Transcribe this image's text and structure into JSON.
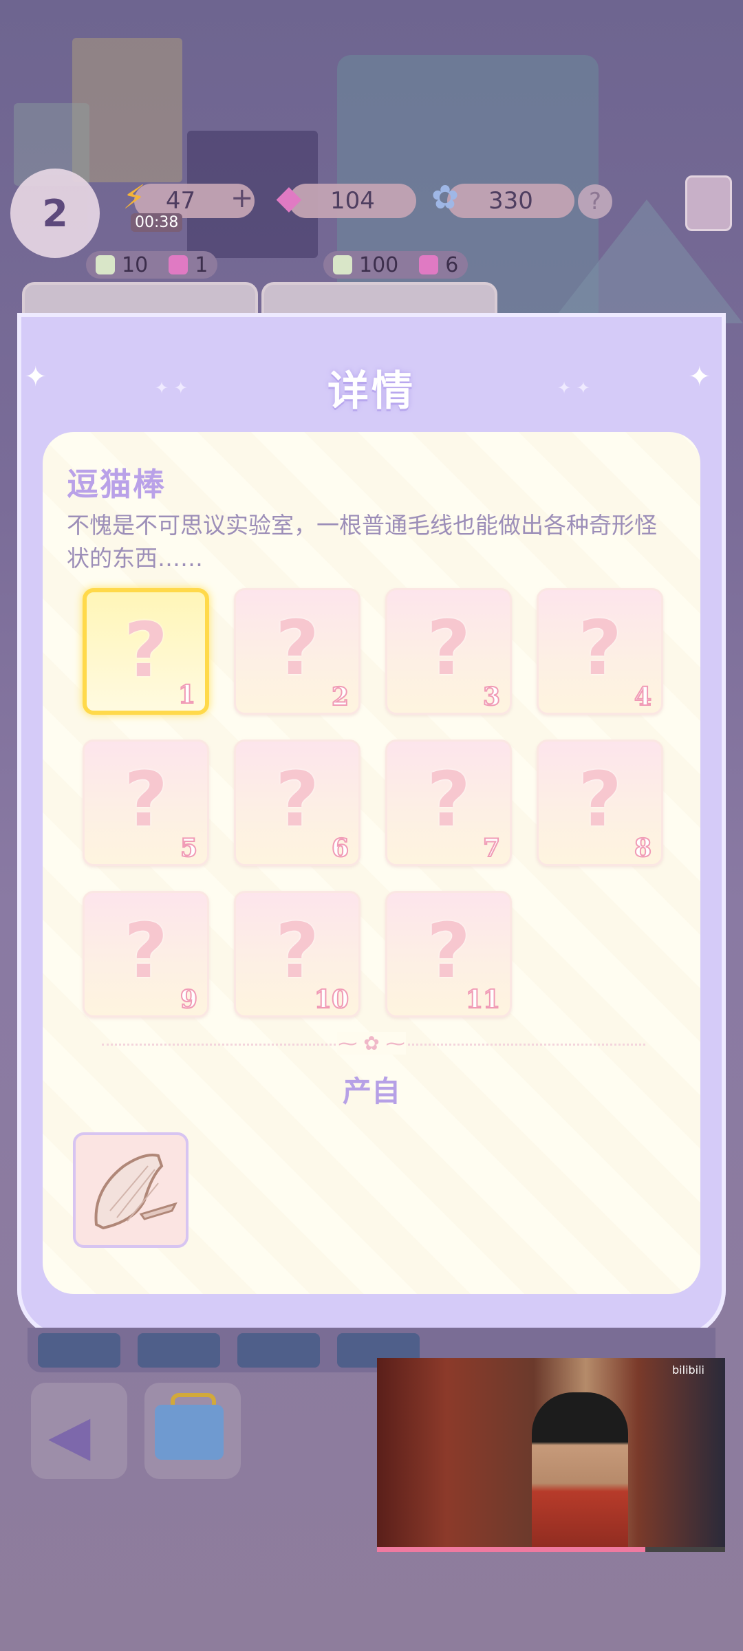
{
  "hud": {
    "level": "2",
    "energy": "47",
    "energy_plus": "+",
    "energy_timer": "00:38",
    "gems": "104",
    "stars": "330",
    "help": "?"
  },
  "shop_items": [
    {
      "price": "10",
      "count": "1"
    },
    {
      "price": "100",
      "count": "6"
    }
  ],
  "dialog": {
    "title": "详情",
    "item_name": "逗猫棒",
    "description": "不愧是不可思议实验室，一根普通毛线也能做出各种奇形怪状的东西……",
    "slots": [
      {
        "label": "?",
        "number": "1"
      },
      {
        "label": "?",
        "number": "2"
      },
      {
        "label": "?",
        "number": "3"
      },
      {
        "label": "?",
        "number": "4"
      },
      {
        "label": "?",
        "number": "5"
      },
      {
        "label": "?",
        "number": "6"
      },
      {
        "label": "?",
        "number": "7"
      },
      {
        "label": "?",
        "number": "8"
      },
      {
        "label": "?",
        "number": "9"
      },
      {
        "label": "?",
        "number": "10"
      },
      {
        "label": "?",
        "number": "11"
      }
    ],
    "source_label": "产自",
    "active_slot": 1
  },
  "video": {
    "brand": "bilibili",
    "progress": 0.77
  }
}
